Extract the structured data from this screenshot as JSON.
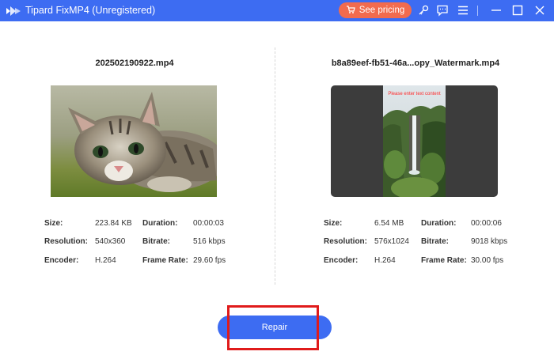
{
  "window": {
    "title": "Tipard FixMP4 (Unregistered)",
    "pricing_label": "See pricing",
    "icons": [
      "logo-icon",
      "cart-icon",
      "key-icon",
      "feedback-icon",
      "menu-icon",
      "minimize-icon",
      "maximize-icon",
      "close-icon"
    ]
  },
  "left": {
    "filename": "202502190922.mp4",
    "thumbnail": "kitten-lying-on-grass",
    "labels": {
      "size": "Size:",
      "resolution": "Resolution:",
      "encoder": "Encoder:",
      "duration": "Duration:",
      "bitrate": "Bitrate:",
      "framerate": "Frame Rate:"
    },
    "size": "223.84 KB",
    "resolution": "540x360",
    "encoder": "H.264",
    "duration": "00:00:03",
    "bitrate": "516 kbps",
    "framerate": "29.60 fps"
  },
  "right": {
    "filename": "b8a89eef-fb51-46a...opy_Watermark.mp4",
    "thumbnail": "waterfall-forest-portrait",
    "watermark_text": "Please enter text content",
    "labels": {
      "size": "Size:",
      "resolution": "Resolution:",
      "encoder": "Encoder:",
      "duration": "Duration:",
      "bitrate": "Bitrate:",
      "framerate": "Frame Rate:"
    },
    "size": "6.54 MB",
    "resolution": "576x1024",
    "encoder": "H.264",
    "duration": "00:00:06",
    "bitrate": "9018 kbps",
    "framerate": "30.00 fps"
  },
  "actions": {
    "repair_label": "Repair"
  },
  "colors": {
    "titlebar": "#3d6cf2",
    "pricing": "#f26b4e",
    "repair": "#3d6cf2",
    "highlight": "#e01b1b"
  }
}
